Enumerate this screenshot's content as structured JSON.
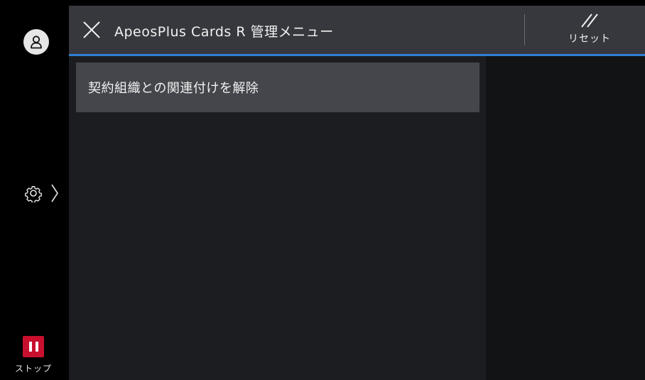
{
  "header": {
    "title": "ApeosPlus Cards R 管理メニュー",
    "reset_label": "リセット"
  },
  "rail": {
    "stop_label": "ストップ"
  },
  "main": {
    "items": [
      {
        "label": "契約組織との関連付けを解除"
      }
    ]
  },
  "colors": {
    "header_bg": "#36383d",
    "accent_line": "#2f7fd2",
    "stop_red": "#c8102e",
    "item_bg": "#44464b",
    "panel_bg": "#1c1d20"
  },
  "icons": {
    "user": "user-icon",
    "settings": "gear-icon",
    "chevron": "chevron-right-icon",
    "close": "close-icon",
    "reset": "reset-icon",
    "stop": "pause-icon"
  }
}
